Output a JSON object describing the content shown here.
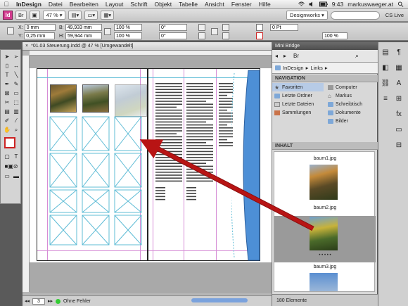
{
  "menubar": {
    "app": "InDesign",
    "items": [
      "Datei",
      "Bearbeiten",
      "Layout",
      "Schrift",
      "Objekt",
      "Tabelle",
      "Ansicht",
      "Fenster",
      "Hilfe"
    ],
    "time": "9:43",
    "user": "markuswaeger.at"
  },
  "appbar": {
    "logo": "Id",
    "zoom": "47 %",
    "workspace": "Designworks",
    "cs_live": "CS Live"
  },
  "control": {
    "x_label": "X:",
    "x": "0 mm",
    "y_label": "Y:",
    "y": "0,25 mm",
    "w_label": "B:",
    "w": "49,933 mm",
    "h_label": "H:",
    "h": "59,944 mm",
    "scale_x": "100 %",
    "scale_y": "100 %",
    "rotate": "0°",
    "shear": "0°",
    "stroke": "0 Pt",
    "stroke_pct": "100 %"
  },
  "document": {
    "tab_title": "*01.03 Steuerung.indd @ 47 % [Umgewandelt]",
    "page_number": "3",
    "preflight": "Ohne Fehler"
  },
  "bridge": {
    "panel_title": "Mini Bridge",
    "path": [
      "InDesign",
      "Links"
    ],
    "navigation_title": "NAVIGATION",
    "nav_left": [
      "Favoriten",
      "Letzte Ordner",
      "Letzte Dateien",
      "Sammlungen"
    ],
    "nav_right": [
      "Computer",
      "Markus",
      "Schreibtisch",
      "Dokumente",
      "Bilder"
    ],
    "content_title": "INHALT",
    "thumbnails": [
      "baum1.jpg",
      "baum2.jpg",
      "baum3.jpg"
    ],
    "status": "180 Elemente"
  },
  "colors": {
    "arrow": "#b81414",
    "guide": "#5fbcd6",
    "margin": "#d68cd6",
    "selection": "#9a9a9a"
  }
}
